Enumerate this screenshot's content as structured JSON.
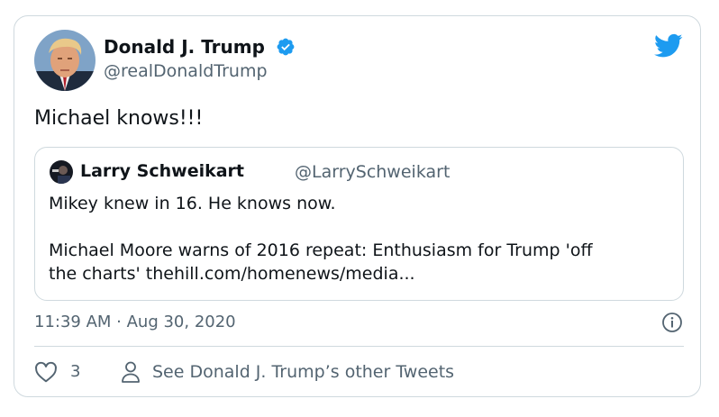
{
  "tweet": {
    "author_name": "Donald J. Trump",
    "author_handle": "@realDonaldTrump",
    "text": "Michael knows!!!",
    "timestamp": "11:39 AM · Aug 30, 2020"
  },
  "quoted_tweet": {
    "author_name": "Larry Schweikart",
    "author_handle": "@LarrySchweikart",
    "line1": "Mikey knew in 16. He knows now.",
    "line2": "Michael Moore warns of 2016 repeat: Enthusiasm for Trump 'off",
    "line3": "the charts' thehill.com/homenews/media..."
  },
  "actions": {
    "like_count": "3",
    "see_more": "See Donald J. Trump’s other Tweets"
  },
  "icons": {
    "verified": "verified-badge-icon",
    "brand": "twitter-bird-icon",
    "info": "info-icon",
    "like": "heart-icon",
    "profile": "person-icon"
  },
  "colors": {
    "twitter_blue": "#1d9bf0",
    "text_primary": "#0f1419",
    "text_secondary": "#536471",
    "border": "#cfd9de"
  }
}
